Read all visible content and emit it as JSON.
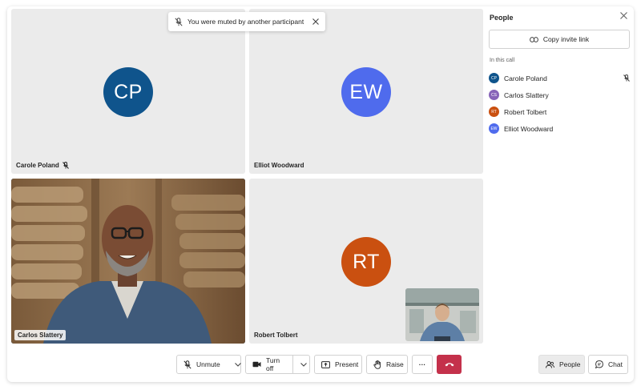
{
  "toast": {
    "text": "You were muted by another participant"
  },
  "tiles": [
    {
      "initials": "CP",
      "name": "Carole Poland",
      "color": "#0f548c"
    },
    {
      "initials": "EW",
      "name": "Elliot Woodward",
      "color": "#4f6bed"
    },
    {
      "name": "Carlos Slattery"
    },
    {
      "initials": "RT",
      "name": "Robert Tolbert",
      "color": "#ca5010"
    }
  ],
  "panel": {
    "title": "People",
    "copy_link": "Copy invite link",
    "section": "In this call",
    "participants": [
      {
        "initials": "CP",
        "name": "Carole Poland",
        "color": "#0f548c",
        "muted": true
      },
      {
        "initials": "CS",
        "name": "Carlos Slattery",
        "color": "#8764b8",
        "muted": false
      },
      {
        "initials": "RT",
        "name": "Robert Tolbert",
        "color": "#ca5010",
        "muted": false
      },
      {
        "initials": "EW",
        "name": "Elliot Woodward",
        "color": "#4f6bed",
        "muted": false
      }
    ]
  },
  "toolbar": {
    "unmute": "Unmute",
    "turn_off": "Turn off",
    "present": "Present",
    "raise": "Raise",
    "more": "···",
    "people": "People",
    "chat": "Chat"
  },
  "colors": {
    "accent": "#0f6cbd",
    "hangup": "#c4314b"
  }
}
